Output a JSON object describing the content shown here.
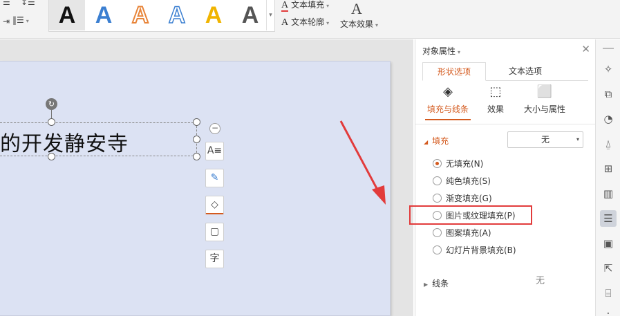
{
  "ribbon": {
    "left_icons": [
      "bullet-icon",
      "line-spacing-icon",
      "indent-icon",
      "paragraph-icon"
    ],
    "art_letter": "A",
    "art_styles": [
      {
        "name": "style-black",
        "color": "#111111",
        "selected": true
      },
      {
        "name": "style-blue",
        "color": "#3b7fd1"
      },
      {
        "name": "style-orange-outline",
        "color": "#e8853a"
      },
      {
        "name": "style-blue-outline",
        "color": "#3b7fd1"
      },
      {
        "name": "style-yellow",
        "color": "#f0b400"
      },
      {
        "name": "style-gray",
        "color": "#555555"
      }
    ],
    "text_fill": "文本填充",
    "text_outline": "文本轮廓",
    "text_effect": "文本效果"
  },
  "slide": {
    "text": "的开发静安寺"
  },
  "float_tools": [
    "text-wrap-icon",
    "pen-icon",
    "fill-icon",
    "outline-icon",
    "font-icon"
  ],
  "panel": {
    "title": "对象属性",
    "tabs": [
      {
        "label": "形状选项",
        "active": true
      },
      {
        "label": "文本选项",
        "active": false
      }
    ],
    "subtabs": [
      {
        "label": "填充与线条",
        "active": true
      },
      {
        "label": "效果",
        "active": false
      },
      {
        "label": "大小与属性",
        "active": false
      }
    ],
    "fill_section": "填充",
    "fill_dropdown_value": "无",
    "fill_options": [
      {
        "label": "无填充(N)",
        "checked": true
      },
      {
        "label": "纯色填充(S)",
        "checked": false
      },
      {
        "label": "渐变填充(G)",
        "checked": false
      },
      {
        "label": "图片或纹理填充(P)",
        "checked": false
      },
      {
        "label": "图案填充(A)",
        "checked": false
      },
      {
        "label": "幻灯片背景填充(B)",
        "checked": false
      }
    ],
    "line_section": "线条",
    "line_value": "无"
  },
  "colors": {
    "accent": "#d45a1e",
    "highlight": "#e23b3b",
    "slide_bg": "#dce2f3"
  }
}
